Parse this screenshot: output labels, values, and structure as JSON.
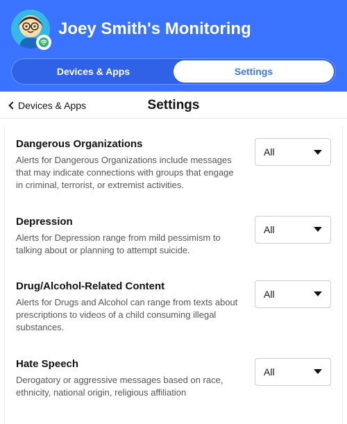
{
  "header": {
    "title": "Joey Smith's Monitoring"
  },
  "tabs": {
    "devices": "Devices & Apps",
    "settings": "Settings"
  },
  "subheader": {
    "back_label": "Devices & Apps",
    "title": "Settings"
  },
  "settings": [
    {
      "title": "Dangerous Organizations",
      "desc": "Alerts for Dangerous Organizations include messages that may indicate connections with groups that engage in criminal, terrorist, or extremist activities.",
      "value": "All"
    },
    {
      "title": "Depression",
      "desc": "Alerts for Depression range from mild pessimism to talking about or planning to attempt suicide.",
      "value": "All"
    },
    {
      "title": "Drug/Alcohol-Related Content",
      "desc": "Alerts for Drugs and Alcohol can range from texts about prescriptions to videos of a child consuming illegal substances.",
      "value": "All"
    },
    {
      "title": "Hate Speech",
      "desc": "Derogatory or aggressive messages based on race, ethnicity, national origin, religious affiliation",
      "value": "All"
    }
  ]
}
